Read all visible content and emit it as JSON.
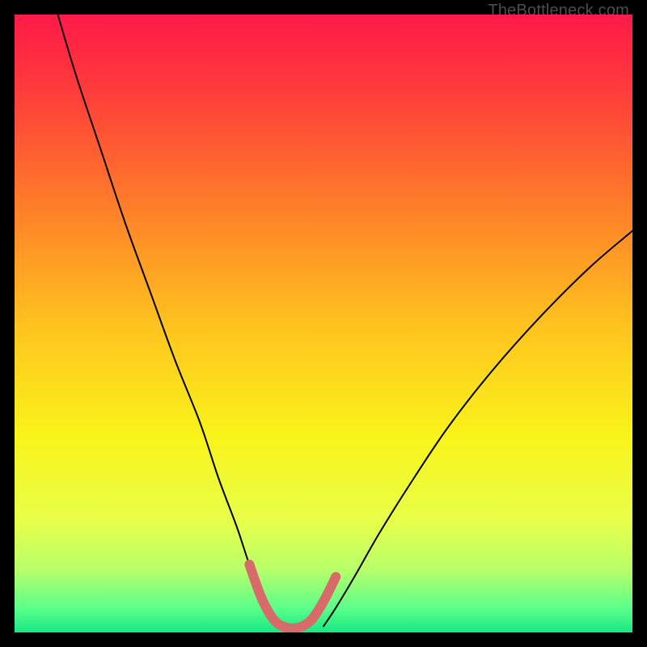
{
  "watermark": "TheBottleneck.com",
  "chart_data": {
    "type": "line",
    "title": "",
    "xlabel": "",
    "ylabel": "",
    "xlim": [
      0,
      100
    ],
    "ylim": [
      0,
      100
    ],
    "grid": false,
    "background_gradient": {
      "stops": [
        {
          "offset": 0.0,
          "color": "#ff1a48"
        },
        {
          "offset": 0.12,
          "color": "#ff3b3b"
        },
        {
          "offset": 0.3,
          "color": "#ff7a2a"
        },
        {
          "offset": 0.5,
          "color": "#ffc21f"
        },
        {
          "offset": 0.68,
          "color": "#f9f31a"
        },
        {
          "offset": 0.82,
          "color": "#e8ff4a"
        },
        {
          "offset": 0.9,
          "color": "#b6ff6a"
        },
        {
          "offset": 0.96,
          "color": "#5cff8a"
        },
        {
          "offset": 1.0,
          "color": "#17e884"
        }
      ]
    },
    "series": [
      {
        "name": "left-curve",
        "color": "#000000",
        "width": 2,
        "x": [
          7,
          10,
          14,
          18,
          22,
          26,
          30,
          33,
          36,
          38,
          40,
          41.5,
          43
        ],
        "y": [
          100,
          90,
          78,
          66,
          55,
          44,
          34,
          25,
          17,
          11,
          6,
          3,
          1
        ]
      },
      {
        "name": "right-curve",
        "color": "#000000",
        "width": 2,
        "x": [
          50,
          52,
          55,
          59,
          64,
          70,
          77,
          85,
          93,
          100
        ],
        "y": [
          1,
          4,
          9,
          16,
          24,
          33,
          42,
          51,
          59,
          65
        ]
      },
      {
        "name": "minimum-marker",
        "color": "#d86a6a",
        "width": 12,
        "x": [
          38,
          40,
          42,
          44,
          46,
          48,
          50,
          52
        ],
        "y": [
          11,
          5.5,
          2,
          0.8,
          0.8,
          2,
          5,
          9
        ]
      }
    ]
  }
}
